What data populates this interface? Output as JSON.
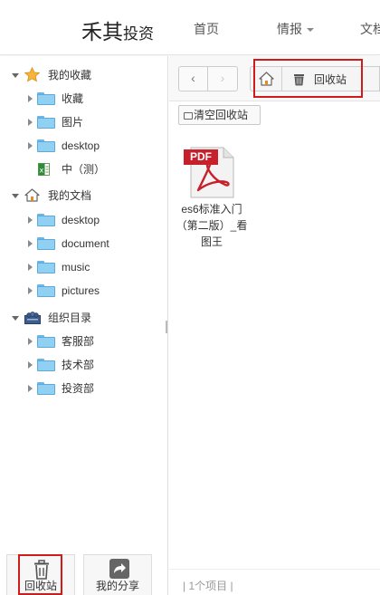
{
  "header": {
    "logo_main": "禾其",
    "logo_sub": "投资",
    "nav": [
      {
        "label": "首页"
      },
      {
        "label": "情报"
      },
      {
        "label": "文档"
      }
    ]
  },
  "tree": {
    "favorites": {
      "label": "我的收藏",
      "items": [
        {
          "label": "收藏"
        },
        {
          "label": "图片"
        },
        {
          "label": "desktop"
        },
        {
          "label": "中（测）"
        }
      ]
    },
    "documents": {
      "label": "我的文档",
      "items": [
        {
          "label": "desktop"
        },
        {
          "label": "document"
        },
        {
          "label": "music"
        },
        {
          "label": "pictures"
        }
      ]
    },
    "org": {
      "label": "组织目录",
      "items": [
        {
          "label": "客服部"
        },
        {
          "label": "技术部"
        },
        {
          "label": "投资部"
        }
      ]
    }
  },
  "bottom_buttons": {
    "recycle": "回收站",
    "share": "我的分享"
  },
  "breadcrumb": {
    "current": "回收站"
  },
  "toolbar": {
    "clear_recycle": "清空回收站"
  },
  "files": [
    {
      "type_badge": "PDF",
      "name": "es6标准入门（第二版）_看图王"
    }
  ],
  "status": "| 1个项目 |",
  "colors": {
    "highlight": "#d01b1b",
    "folder": "#8fd0f3",
    "pdf_badge": "#c8202a"
  }
}
